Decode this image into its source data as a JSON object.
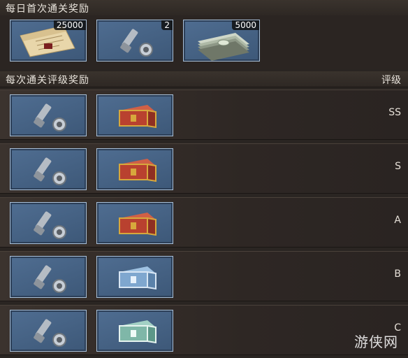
{
  "daily_first_clear": {
    "title": "每日首次通关奖励",
    "items": [
      {
        "icon": "document-scroll-icon",
        "count": "25000"
      },
      {
        "icon": "bolt-screw-icon",
        "count": "2"
      },
      {
        "icon": "cash-stack-icon",
        "count": "5000"
      }
    ]
  },
  "grade_rewards": {
    "title": "每次通关评级奖励",
    "grade_header": "评级",
    "rows": [
      {
        "grade": "SS",
        "items": [
          "bolt-screw-icon",
          "red-gold-chest-icon"
        ]
      },
      {
        "grade": "S",
        "items": [
          "bolt-screw-icon",
          "red-gold-chest-icon"
        ]
      },
      {
        "grade": "A",
        "items": [
          "bolt-screw-icon",
          "red-gold-chest-icon"
        ]
      },
      {
        "grade": "B",
        "items": [
          "bolt-screw-icon",
          "blue-chest-icon"
        ]
      },
      {
        "grade": "C",
        "items": [
          "bolt-screw-icon",
          "green-chest-icon"
        ]
      }
    ]
  },
  "watermark": "游侠网",
  "colors": {
    "slot_blue": "#4b6a8e",
    "red_chest": "#b9412f",
    "gold_trim": "#d7a83c",
    "blue_chest": "#7fa7cf",
    "green_chest": "#7fb7a8"
  }
}
